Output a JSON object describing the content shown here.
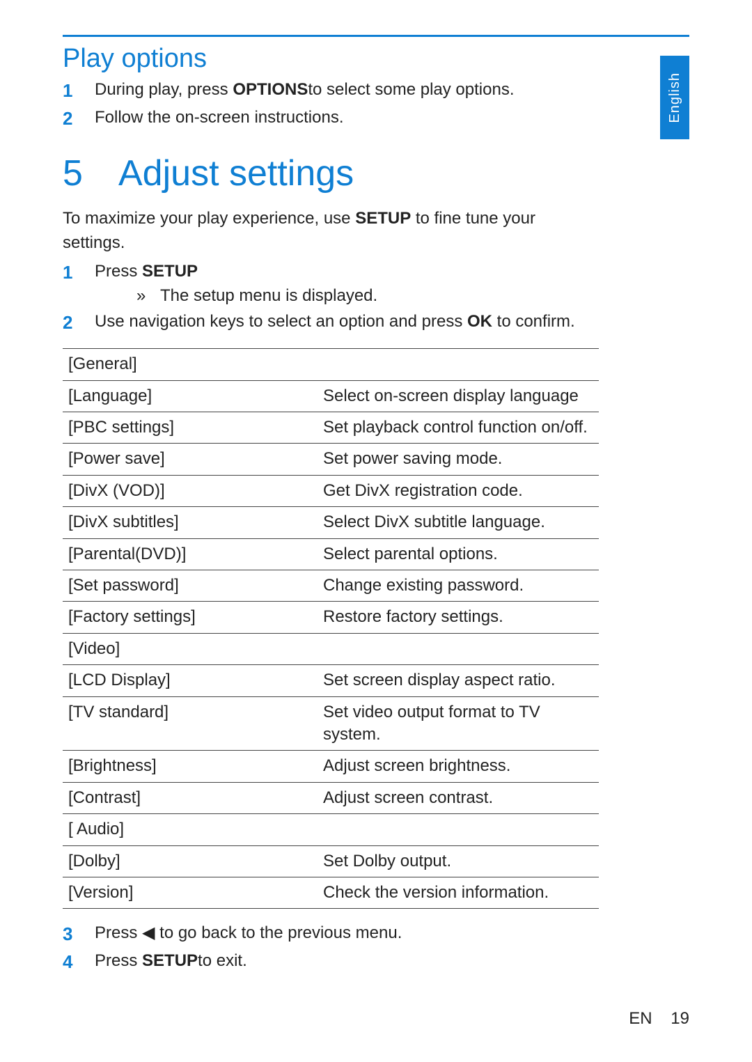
{
  "lang_tab": "English",
  "play_options": {
    "heading": "Play options",
    "steps": {
      "s1_pre": "During play, press ",
      "s1_bold": "OPTIONS",
      "s1_post": "to select some play options.",
      "s2": "Follow the on-screen instructions."
    }
  },
  "chapter": {
    "num": "5",
    "title": "Adjust settings"
  },
  "intro": {
    "pre": "To maximize your play experience, use ",
    "bold": "SETUP",
    "post": " to fine tune your settings."
  },
  "steps": {
    "s1_pre": "Press ",
    "s1_bold": "SETUP",
    "s1_sub": "The setup menu is displayed.",
    "s2_pre": "Use navigation keys to select an option and press ",
    "s2_bold": "OK",
    "s2_post": " to confirm.",
    "s3_pre": "Press ",
    "s3_icon": "◀",
    "s3_post": " to go back to the previous menu.",
    "s4_pre": "Press ",
    "s4_bold": "SETUP",
    "s4_post": "to exit."
  },
  "settings_table": [
    {
      "key": "[General]",
      "desc": ""
    },
    {
      "key": "[Language]",
      "desc": "Select on-screen display language"
    },
    {
      "key": "[PBC settings]",
      "desc": "Set playback control function on/off."
    },
    {
      "key": "[Power save]",
      "desc": "Set power saving mode."
    },
    {
      "key": "[DivX (VOD)]",
      "desc": "Get DivX registration code."
    },
    {
      "key": "[DivX subtitles]",
      "desc": "Select DivX subtitle language."
    },
    {
      "key": "[Parental(DVD)]",
      "desc": "Select parental options."
    },
    {
      "key": "[Set password]",
      "desc": "Change existing password."
    },
    {
      "key": "[Factory settings]",
      "desc": "Restore factory settings."
    },
    {
      "key": "[Video]",
      "desc": ""
    },
    {
      "key": "[LCD Display]",
      "desc": "Set screen display aspect ratio."
    },
    {
      "key": "[TV standard]",
      "desc": "Set video output format to TV system."
    },
    {
      "key": "[Brightness]",
      "desc": "Adjust screen brightness."
    },
    {
      "key": "[Contrast]",
      "desc": "Adjust screen contrast."
    },
    {
      "key": "[ Audio]",
      "desc": ""
    },
    {
      "key": "[Dolby]",
      "desc": "Set Dolby output."
    },
    {
      "key": "[Version]",
      "desc": "Check the version information."
    }
  ],
  "footer": {
    "lang": "EN",
    "page": "19"
  }
}
